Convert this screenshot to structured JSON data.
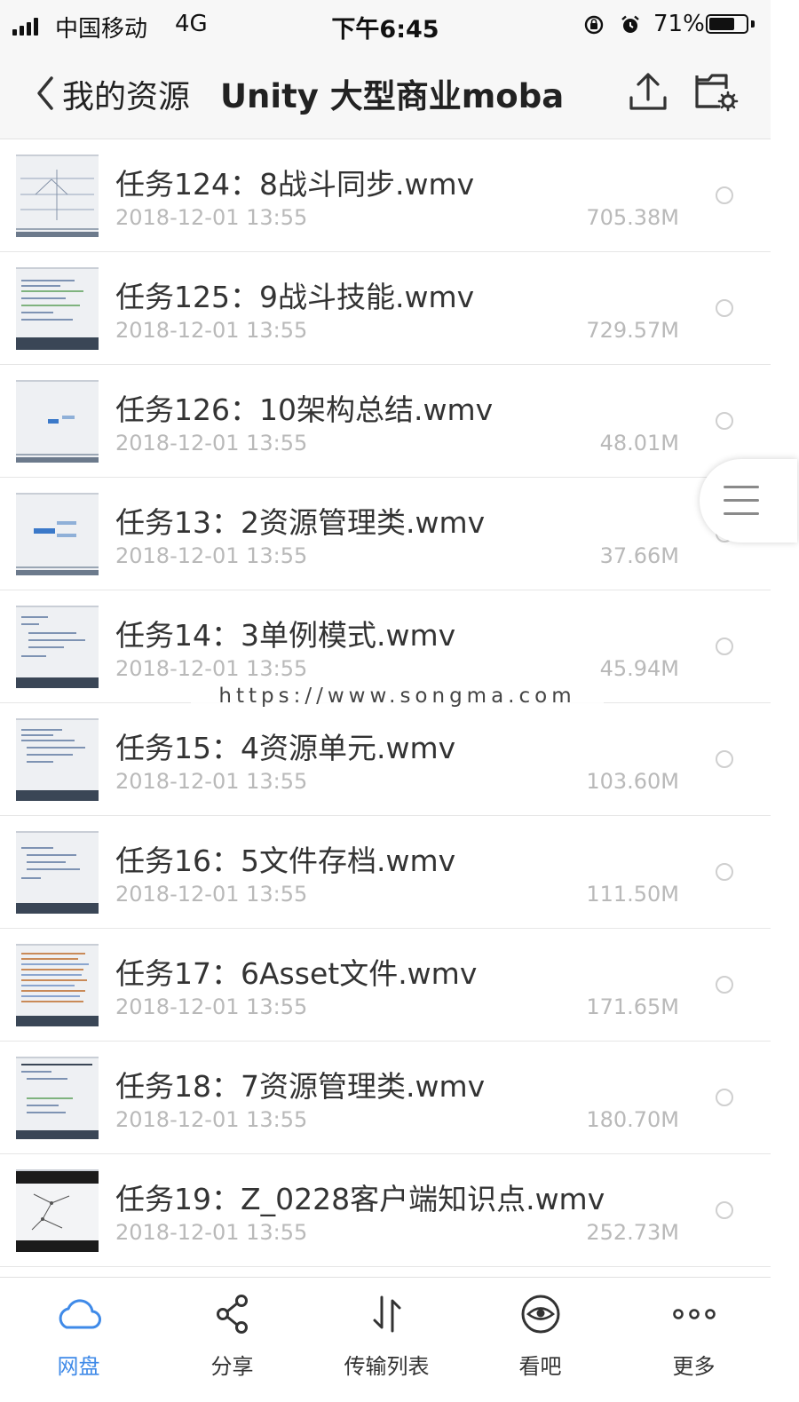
{
  "status_bar": {
    "carrier": "中国移动",
    "network": "4G",
    "time": "下午6:45",
    "battery": "71%",
    "battery_level": 0.71
  },
  "nav": {
    "back_label": "我的资源",
    "title": "Unity 大型商业moba",
    "upload_icon": "upload-icon",
    "folder_settings_icon": "folder-settings-icon"
  },
  "files": [
    {
      "name": "任务124：8战斗同步.wmv",
      "date": "2018-12-01 13:55",
      "size": "705.38M"
    },
    {
      "name": "任务125：9战斗技能.wmv",
      "date": "2018-12-01 13:55",
      "size": "729.57M"
    },
    {
      "name": "任务126：10架构总结.wmv",
      "date": "2018-12-01 13:55",
      "size": "48.01M"
    },
    {
      "name": "任务13：2资源管理类.wmv",
      "date": "2018-12-01 13:55",
      "size": "37.66M"
    },
    {
      "name": "任务14：3单例模式.wmv",
      "date": "2018-12-01 13:55",
      "size": "45.94M"
    },
    {
      "name": "任务15：4资源单元.wmv",
      "date": "2018-12-01 13:55",
      "size": "103.60M"
    },
    {
      "name": "任务16：5文件存档.wmv",
      "date": "2018-12-01 13:55",
      "size": "111.50M"
    },
    {
      "name": "任务17：6Asset文件.wmv",
      "date": "2018-12-01 13:55",
      "size": "171.65M"
    },
    {
      "name": "任务18：7资源管理类.wmv",
      "date": "2018-12-01 13:55",
      "size": "180.70M"
    },
    {
      "name": "任务19：Z_0228客户端知识点.wmv",
      "date": "2018-12-01 13:55",
      "size": "252.73M"
    }
  ],
  "watermark": "https://www.songma.com",
  "tabs": [
    {
      "label": "网盘",
      "icon": "cloud-icon",
      "active": true
    },
    {
      "label": "分享",
      "icon": "share-icon"
    },
    {
      "label": "传输列表",
      "icon": "transfer-icon"
    },
    {
      "label": "看吧",
      "icon": "eye-icon"
    },
    {
      "label": "更多",
      "icon": "more-icon"
    }
  ],
  "colors": {
    "accent": "#3f8ae8",
    "text": "#333333",
    "muted": "#b9b9b9",
    "bar_bg": "#f7f7f7"
  }
}
